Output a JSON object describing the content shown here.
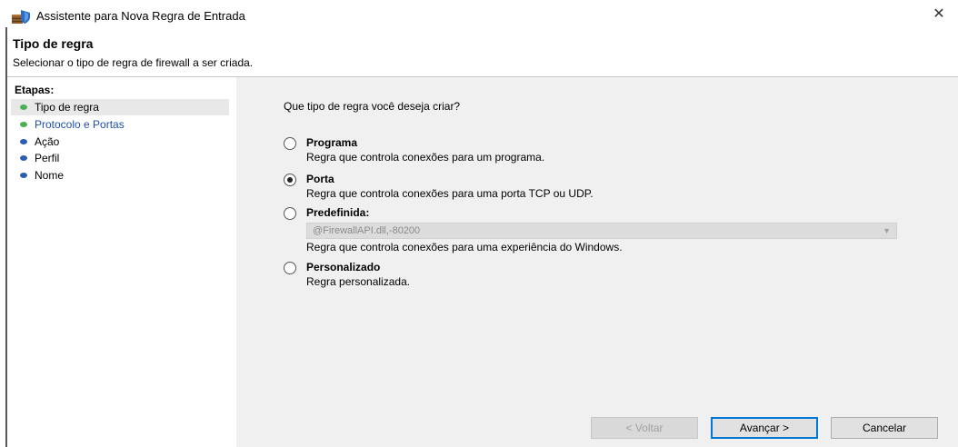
{
  "window": {
    "title": "Assistente para Nova Regra de Entrada",
    "close_glyph": "✕"
  },
  "header": {
    "title": "Tipo de regra",
    "subtitle": "Selecionar o tipo de regra de firewall a ser criada."
  },
  "steps": {
    "heading": "Etapas:",
    "items": [
      {
        "label": "Tipo de regra",
        "bullet_color": "#4caf50"
      },
      {
        "label": "Protocolo e Portas",
        "bullet_color": "#4caf50"
      },
      {
        "label": "Ação",
        "bullet_color": "#2a5db0"
      },
      {
        "label": "Perfil",
        "bullet_color": "#2a5db0"
      },
      {
        "label": "Nome",
        "bullet_color": "#2a5db0"
      }
    ]
  },
  "content": {
    "question": "Que tipo de regra você deseja criar?",
    "options": [
      {
        "label": "Programa",
        "description": "Regra que controla conexões para um programa.",
        "selected": false
      },
      {
        "label": "Porta",
        "description": "Regra que controla conexões para uma porta TCP ou UDP.",
        "selected": true
      },
      {
        "label": "Predefinida:",
        "select_value": "@FirewallAPI.dll,-80200",
        "description": "Regra que controla conexões para uma experiência do Windows.",
        "selected": false
      },
      {
        "label": "Personalizado",
        "description": "Regra personalizada.",
        "selected": false
      }
    ]
  },
  "buttons": {
    "back": "< Voltar",
    "next": "Avançar >",
    "cancel": "Cancelar"
  },
  "colors": {
    "accent": "#0078d7",
    "link": "#1f4fb0"
  }
}
